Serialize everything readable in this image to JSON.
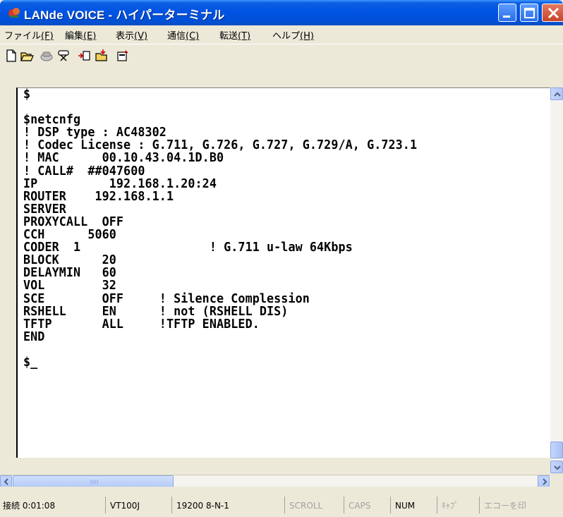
{
  "window": {
    "title": "LANde VOICE - ハイパーターミナル",
    "colors": {
      "titlebar": "#0054e3",
      "close": "#c7452b",
      "face": "#ece9d8"
    }
  },
  "menu": [
    {
      "label": "ファイル",
      "accel": "(F)"
    },
    {
      "label": "編集",
      "accel": "(E)"
    },
    {
      "label": "表示",
      "accel": "(V)"
    },
    {
      "label": "通信",
      "accel": "(C)"
    },
    {
      "label": "転送",
      "accel": "(T)"
    },
    {
      "label": "ヘルプ",
      "accel": "(H)"
    }
  ],
  "toolbar": {
    "icons": [
      "new-connection-icon",
      "open-icon",
      "connect-icon",
      "disconnect-icon",
      "send-icon",
      "receive-icon",
      "properties-icon"
    ]
  },
  "terminal": {
    "lines": [
      "$",
      "",
      "$netcnfg",
      "! DSP type : AC48302",
      "! Codec License : G.711, G.726, G.727, G.729/A, G.723.1",
      "! MAC      00.10.43.04.1D.B0",
      "! CALL#  ##047600",
      "IP          192.168.1.20:24",
      "ROUTER    192.168.1.1",
      "SERVER",
      "PROXYCALL  OFF",
      "CCH      5060",
      "CODER  1                  ! G.711 u-law 64Kbps",
      "BLOCK      20",
      "DELAYMIN   60",
      "VOL        32",
      "SCE        OFF     ! Silence Complession",
      "RSHELL     EN      ! not (RSHELL DIS)",
      "TFTP       ALL     !TFTP ENABLED.",
      "END",
      "",
      "$_"
    ]
  },
  "status": {
    "connected": "接続 0:01:08",
    "emulation": "VT100J",
    "port": "19200 8-N-1",
    "scroll": "SCROLL",
    "caps": "CAPS",
    "num": "NUM",
    "kana": "ｷｬﾌﾟ",
    "echo": "エコーを印"
  }
}
